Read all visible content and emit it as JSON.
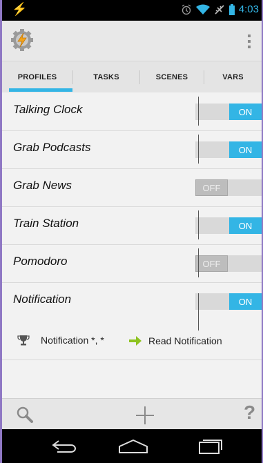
{
  "status": {
    "time": "4:03"
  },
  "tabs": [
    {
      "label": "PROFILES",
      "selected": true
    },
    {
      "label": "TASKS",
      "selected": false
    },
    {
      "label": "SCENES",
      "selected": false
    },
    {
      "label": "VARS",
      "selected": false
    }
  ],
  "profiles": [
    {
      "name": "Talking Clock",
      "state": "ON"
    },
    {
      "name": "Grab Podcasts",
      "state": "ON"
    },
    {
      "name": "Grab News",
      "state": "OFF"
    },
    {
      "name": "Train Station",
      "state": "ON"
    },
    {
      "name": "Pomodoro",
      "state": "OFF"
    },
    {
      "name": "Notification",
      "state": "ON"
    }
  ],
  "detail": {
    "context": "Notification *, *",
    "task": "Read Notification"
  },
  "bottombar": {
    "help_label": "?"
  },
  "colors": {
    "accent": "#33b5e5",
    "arrow": "#8dc21f"
  },
  "icons": [
    "tasker-app-icon",
    "overflow-menu-icon",
    "search-icon",
    "plus-icon",
    "help-icon",
    "back-icon",
    "home-icon",
    "recents-icon",
    "trophy-icon",
    "arrow-right-icon"
  ]
}
